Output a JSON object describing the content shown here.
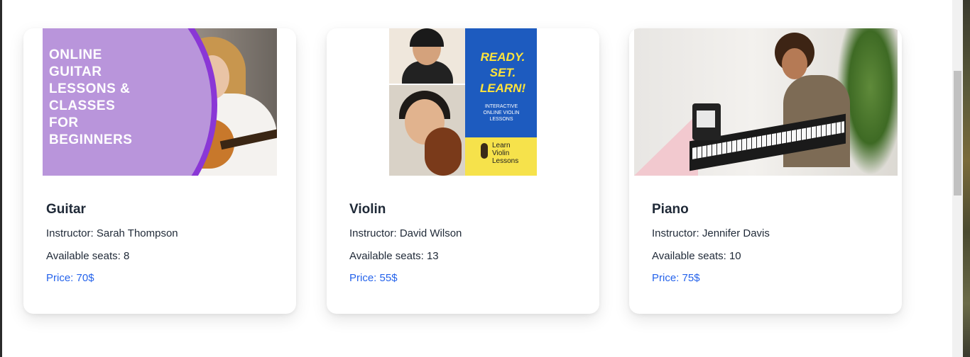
{
  "cards": [
    {
      "name": "Guitar",
      "instructor": "Instructor: Sarah Thompson",
      "seats": "Available seats: 8",
      "price": "Price: 70$",
      "image_text": [
        "ONLINE",
        "GUITAR",
        "LESSONS &",
        "CLASSES",
        "FOR",
        "BEGINNERS"
      ]
    },
    {
      "name": "Violin",
      "instructor": "Instructor: David Wilson",
      "seats": "Available seats: 13",
      "price": "Price: 55$",
      "image_text": {
        "headline": [
          "READY.",
          "SET.",
          "LEARN!"
        ],
        "sub": [
          "INTERACTIVE",
          "ONLINE VIOLIN",
          "LESSONS"
        ],
        "logo": [
          "Learn",
          "Violin",
          "Lessons"
        ]
      }
    },
    {
      "name": "Piano",
      "instructor": "Instructor: Jennifer Davis",
      "seats": "Available seats: 10",
      "price": "Price: 75$"
    }
  ],
  "colors": {
    "price": "#2563eb",
    "title": "#1f2937",
    "guitar_badge": "#b995db",
    "violin_blue": "#1d5bbf",
    "violin_yellow": "#f6e24b"
  }
}
